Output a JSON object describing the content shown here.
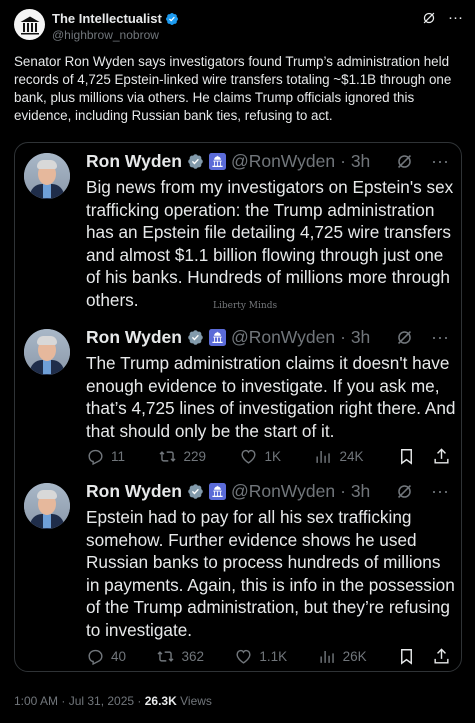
{
  "post": {
    "author_name": "The Intellectualist",
    "author_handle": "@highbrow_nobrow",
    "text": "Senator Ron Wyden says investigators found Trump’s administration held records of 4,725 Epstein-linked wire transfers totaling ~$1.1B through one bank, plus millions via others. He claims Trump officials ignored this evidence, including Russian bank ties, refusing to act.",
    "more_glyph": "···",
    "timestamp": "1:00 AM · Jul 31, 2025 · ",
    "views_count": "26.3K",
    "views_label": " Views"
  },
  "embedded": {
    "watermark": "Liberty Minds",
    "tweets": [
      {
        "name": "Ron Wyden",
        "handle": "@RonWyden",
        "time": "· 3h",
        "more": "···",
        "text": "Big news from my investigators on Epstein's sex trafficking operation: the Trump administration has an Epstein file detailing 4,725 wire transfers and almost $1.1 billion flowing through just one of his banks. Hundreds of millions more through others."
      },
      {
        "name": "Ron Wyden",
        "handle": "@RonWyden",
        "time": "· 3h",
        "more": "···",
        "text": "The Trump administration claims it doesn't have enough evidence to investigate. If you ask me, that’s 4,725 lines of investigation right there. And that should only be the start of it.",
        "replies": "11",
        "reposts": "229",
        "likes": "1K",
        "views": "24K"
      },
      {
        "name": "Ron Wyden",
        "handle": "@RonWyden",
        "time": "· 3h",
        "more": "···",
        "text": "Epstein had to pay for all his sex trafficking somehow. Further evidence shows he used Russian banks to process hundreds of millions in payments. Again, this is info in the possession of the Trump administration, but they’re refusing to investigate.",
        "replies": "40",
        "reposts": "362",
        "likes": "1.1K",
        "views": "26K"
      }
    ]
  },
  "colors": {
    "background": "#000000",
    "text": "#e7e9ea",
    "muted": "#71767b",
    "verified": "#1d9bf0",
    "border": "#2f3336"
  },
  "icons": [
    "verified-icon",
    "grok-icon",
    "more-icon",
    "reply-icon",
    "repost-icon",
    "like-icon",
    "views-icon",
    "bookmark-icon",
    "share-icon",
    "capitol-icon"
  ]
}
